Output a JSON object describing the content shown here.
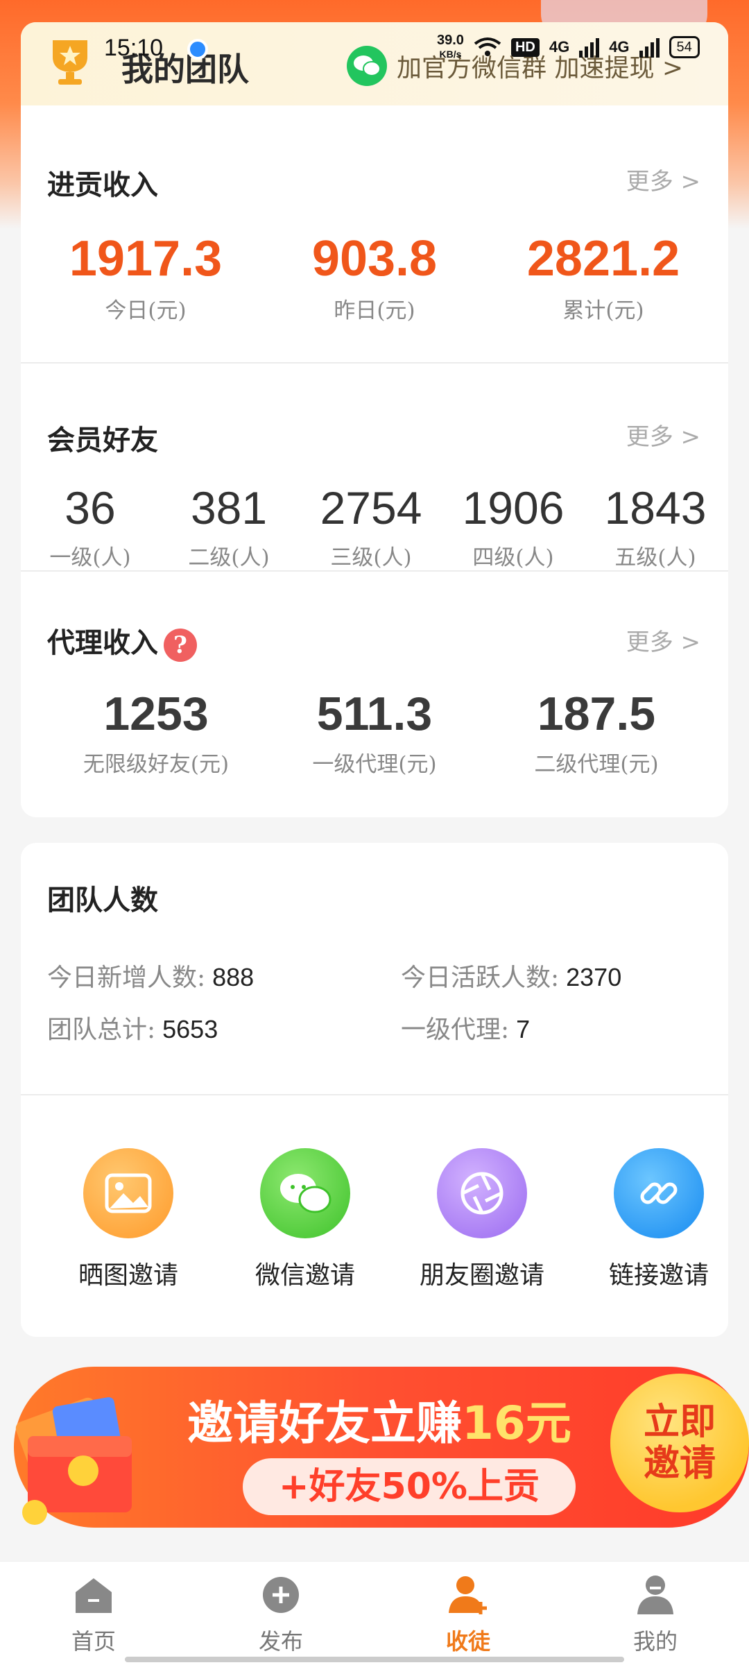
{
  "status_bar": {
    "time": "15:10",
    "net_speed": "39.0",
    "net_unit": "KB/s",
    "hd": "HD",
    "signal1": "4G",
    "signal2": "4G",
    "battery": "54"
  },
  "team_header": {
    "title": "我的团队",
    "wechat_text": "加官方微信群 加速提现 >"
  },
  "contrib_income": {
    "title": "进贡收入",
    "more": "更多 >",
    "stats": [
      {
        "value": "1917.3",
        "label": "今日(元)"
      },
      {
        "value": "903.8",
        "label": "昨日(元)"
      },
      {
        "value": "2821.2",
        "label": "累计(元)"
      }
    ]
  },
  "member_friends": {
    "title": "会员好友",
    "more": "更多 >",
    "stats": [
      {
        "value": "36",
        "label": "一级(人)"
      },
      {
        "value": "381",
        "label": "二级(人)"
      },
      {
        "value": "2754",
        "label": "三级(人)"
      },
      {
        "value": "1906",
        "label": "四级(人)"
      },
      {
        "value": "1843",
        "label": "五级(人)"
      }
    ]
  },
  "agent_income": {
    "title": "代理收入",
    "help": "?",
    "more": "更多 >",
    "stats": [
      {
        "value": "1253",
        "label": "无限级好友(元)"
      },
      {
        "value": "511.3",
        "label": "一级代理(元)"
      },
      {
        "value": "187.5",
        "label": "二级代理(元)"
      }
    ]
  },
  "team_count": {
    "title": "团队人数",
    "today_new_label": "今日新增人数:",
    "today_new_value": "888",
    "today_active_label": "今日活跃人数:",
    "today_active_value": "2370",
    "total_label": "团队总计:",
    "total_value": "5653",
    "agent_label": "一级代理:",
    "agent_value": "7"
  },
  "invite_options": [
    {
      "label": "晒图邀请",
      "icon": "photo-icon",
      "color": "#ffa23a"
    },
    {
      "label": "微信邀请",
      "icon": "wechat-icon",
      "color": "#4cd137"
    },
    {
      "label": "朋友圈邀请",
      "icon": "aperture-icon",
      "color": "#a87cf5"
    },
    {
      "label": "链接邀请",
      "icon": "link-icon",
      "color": "#1e9bf5"
    }
  ],
  "banner": {
    "main_prefix": "邀请好友立赚",
    "main_amount": "16元",
    "sub": "+好友50%上贡",
    "button_line1": "立即",
    "button_line2": "邀请"
  },
  "bottom_nav": [
    {
      "label": "首页",
      "icon": "home-icon"
    },
    {
      "label": "发布",
      "icon": "publish-icon"
    },
    {
      "label": "收徒",
      "icon": "recruit-icon",
      "active": true
    },
    {
      "label": "我的",
      "icon": "profile-icon"
    }
  ],
  "colors": {
    "accent": "#f0561a",
    "active_nav": "#f07a1a"
  }
}
